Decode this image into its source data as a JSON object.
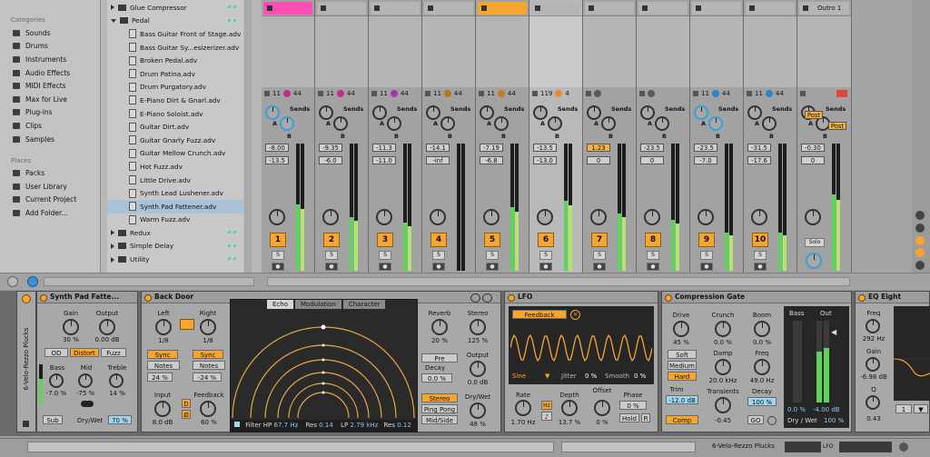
{
  "browser": {
    "categories_header": "Categories",
    "categories": [
      {
        "label": "Sounds",
        "icon": "sounds-icon"
      },
      {
        "label": "Drums",
        "icon": "drums-icon"
      },
      {
        "label": "Instruments",
        "icon": "instruments-icon"
      },
      {
        "label": "Audio Effects",
        "icon": "audio-effects-icon"
      },
      {
        "label": "MIDI Effects",
        "icon": "midi-effects-icon"
      },
      {
        "label": "Max for Live",
        "icon": "max-icon"
      },
      {
        "label": "Plug-ins",
        "icon": "plugins-icon"
      },
      {
        "label": "Clips",
        "icon": "clips-icon"
      },
      {
        "label": "Samples",
        "icon": "samples-icon"
      }
    ],
    "places_header": "Places",
    "places": [
      {
        "label": "Packs",
        "icon": "packs-icon"
      },
      {
        "label": "User Library",
        "icon": "user-library-icon"
      },
      {
        "label": "Current Project",
        "icon": "project-icon"
      },
      {
        "label": "Add Folder...",
        "icon": "add-folder-icon"
      }
    ],
    "files": [
      {
        "label": "Glue Compressor",
        "kind": "folder",
        "open": false
      },
      {
        "label": "Pedal",
        "kind": "folder",
        "open": true
      },
      {
        "label": "Bass Guitar Front of Stage.adv",
        "kind": "file"
      },
      {
        "label": "Bass Guitar Sy...esizerizer.adv",
        "kind": "file"
      },
      {
        "label": "Broken Pedal.adv",
        "kind": "file"
      },
      {
        "label": "Drum Patina.adv",
        "kind": "file"
      },
      {
        "label": "Drum Purgatory.adv",
        "kind": "file"
      },
      {
        "label": "E-Piano Dirt & Gnarl.adv",
        "kind": "file"
      },
      {
        "label": "E-Piano Soloist.adv",
        "kind": "file"
      },
      {
        "label": "Guitar Dirt.adv",
        "kind": "file"
      },
      {
        "label": "Guitar Gnarly Fuzz.adv",
        "kind": "file"
      },
      {
        "label": "Guitar Mellow Crunch.adv",
        "kind": "file"
      },
      {
        "label": "Hot Fuzz.adv",
        "kind": "file"
      },
      {
        "label": "Little Drive.adv",
        "kind": "file"
      },
      {
        "label": "Synth Lead Lushener.adv",
        "kind": "file"
      },
      {
        "label": "Synth Pad Fattener.adv",
        "kind": "file",
        "selected": true
      },
      {
        "label": "Warm Fuzz.adv",
        "kind": "file"
      },
      {
        "label": "Redux",
        "kind": "folder",
        "open": false
      },
      {
        "label": "Simple Delay",
        "kind": "folder",
        "open": false
      },
      {
        "label": "Utility",
        "kind": "folder",
        "open": false
      }
    ]
  },
  "mixer": {
    "scene_label": "Outro 1",
    "sends_label": "Sends",
    "send_a": "A",
    "send_b": "B",
    "post_label": "Post",
    "solo_label": "Solo",
    "s_label": "S",
    "scale": [
      "6",
      "0",
      "6",
      "12",
      "18",
      "24",
      "30",
      "36",
      "42",
      "48",
      "54",
      "60"
    ],
    "tracks": [
      {
        "num": "1",
        "io_a": "11",
        "io_b": "44",
        "ball": "#c42d8f",
        "vol": "-8.00",
        "pan": "-13.5",
        "clip": "#ff4fb5",
        "level": 0.52,
        "active": true
      },
      {
        "num": "2",
        "io_a": "11",
        "io_b": "44",
        "ball": "#c42d8f",
        "vol": "-9.35",
        "pan": "-6.0",
        "clip": "",
        "level": 0.42,
        "active": true
      },
      {
        "num": "3",
        "io_a": "11",
        "io_b": "44",
        "ball": "#a23aa9",
        "vol": "-11.3",
        "pan": "-11.0",
        "clip": "",
        "level": 0.38,
        "active": true
      },
      {
        "num": "4",
        "io_a": "11",
        "io_b": "44",
        "ball": "#b07a18",
        "vol": "-14.1",
        "pan": "-inf",
        "clip": "",
        "level": 0.0,
        "active": true
      },
      {
        "num": "5",
        "io_a": "11",
        "io_b": "44",
        "ball": "#c07c22",
        "vol": "-7.19",
        "pan": "-6.8",
        "clip": "#f6a531",
        "level": 0.5,
        "active": true
      },
      {
        "num": "6",
        "io_a": "119",
        "io_b": "4",
        "ball": "#e98a2f",
        "vol": "-13.5",
        "pan": "-13.0",
        "clip": "",
        "level": 0.55,
        "active": true
      },
      {
        "num": "7",
        "io_a": "",
        "io_b": "",
        "ball": "#5a5a5a",
        "vol": "1.23",
        "pan": "0",
        "clip": "",
        "level": 0.45,
        "active": true
      },
      {
        "num": "8",
        "io_a": "",
        "io_b": "",
        "ball": "#5a5a5a",
        "vol": "-23.5",
        "pan": "0",
        "clip": "",
        "level": 0.4,
        "active": true
      },
      {
        "num": "9",
        "io_a": "11",
        "io_b": "44",
        "ball": "#2f84c6",
        "vol": "-23.5",
        "pan": "-7.0",
        "clip": "",
        "level": 0.3,
        "active": true
      },
      {
        "num": "10",
        "io_a": "11",
        "io_b": "44",
        "ball": "#2f84c6",
        "vol": "-31.5",
        "pan": "-17.6",
        "clip": "",
        "level": 0.3,
        "active": true
      },
      {
        "num": "",
        "io_a": "",
        "io_b": "",
        "ball": "",
        "vol": "-0.30",
        "pan": "0",
        "clip": "",
        "level": 0.6,
        "active": false
      }
    ]
  },
  "devices": {
    "rack_label": "6-Velo-Rezzo Plucks",
    "fattener": {
      "title": "Synth Pad Fatte...",
      "gain_label": "Gain",
      "gain": "30 %",
      "output_label": "Output",
      "output": "0.00 dB",
      "od": "OD",
      "distort": "Distort",
      "fuzz": "Fuzz",
      "bass_label": "Bass",
      "bass": "-7.0 %",
      "mid_label": "Mid",
      "mid": "-75 %",
      "treble_label": "Treble",
      "treble": "14 %",
      "sub": "Sub",
      "drywet_label": "Dry/Wet",
      "drywet": "70 %"
    },
    "backdoor": {
      "title": "Back Door",
      "left_label": "Left",
      "left": "1/8",
      "right_label": "Right",
      "right": "1/8",
      "sync": "Sync",
      "notes": "Notes",
      "left_pct": "24 %",
      "right_pct": "-24 %",
      "input_label": "Input",
      "input": "8.0 dB",
      "feedback_label": "Feedback",
      "feedback": "60 %",
      "d": "D",
      "phi": "Ø",
      "tabs": [
        "Echo",
        "Modulation",
        "Character"
      ],
      "filter_hp_label": "Filter HP",
      "filter_hp": "67.7 Hz",
      "res1_label": "Res",
      "res1": "0.14",
      "lp_label": "LP",
      "lp": "2.79 kHz",
      "res2_label": "Res",
      "res2": "0.12",
      "reverb_label": "Reverb",
      "reverb": "20 %",
      "stereo_label": "Stereo",
      "stereo": "125 %",
      "pre": "Pre",
      "decay_label": "Decay",
      "decay": "0.0 %",
      "output_label": "Output",
      "output": "0.0 dB",
      "mode_stereo": "Stereo",
      "mode_ping": "Ping Pong",
      "mode_mid": "Mid/Side",
      "drywet_label": "Dry/Wet",
      "drywet": "48 %"
    },
    "lfo": {
      "title": "LFO",
      "feedback": "Feedback",
      "wave": "Sine",
      "jitter_label": "Jitter",
      "jitter": "0 %",
      "smooth_label": "Smooth",
      "smooth": "0 %",
      "rate_label": "Rate",
      "rate": "1.70 Hz",
      "hz": "Hz",
      "depth_label": "Depth",
      "depth": "13.7 %",
      "offset_label": "Offset",
      "offset": "0 %",
      "phase_label": "Phase",
      "phase": "0 %",
      "hold": "Hold",
      "r": "R"
    },
    "comp": {
      "title": "Compression Gate",
      "drive_label": "Drive",
      "drive": "45 %",
      "crunch_label": "Crunch",
      "crunch": "0.0 %",
      "boom_label": "Boom",
      "boom": "0.0 %",
      "soft": "Soft",
      "medium": "Medium",
      "hard": "Hard",
      "damp_label": "Damp",
      "damp": "20.0 kHz",
      "freq_label": "Freq",
      "freq": "49.0 Hz",
      "trim_label": "Trim",
      "trim": "-12.0 dB",
      "transients_label": "Transients",
      "transients": "-0.45",
      "decay_label": "Decay",
      "decay": "100 %",
      "comp": "Comp",
      "go": "GO",
      "bass_label": "Bass",
      "out_label": "Out",
      "bass_val": "0.0 %",
      "out_val": "-4.00 dB",
      "drywet_label": "Dry / Wet",
      "drywet": "100 %"
    },
    "eq": {
      "title": "EQ Eight",
      "freq_label": "Freq",
      "freq": "292 Hz",
      "gain_label": "Gain",
      "gain": "-6.98 dB",
      "q_label": "Q",
      "q": "0.43",
      "band": "1"
    }
  },
  "status": {
    "lfo_tag": "LFO"
  }
}
